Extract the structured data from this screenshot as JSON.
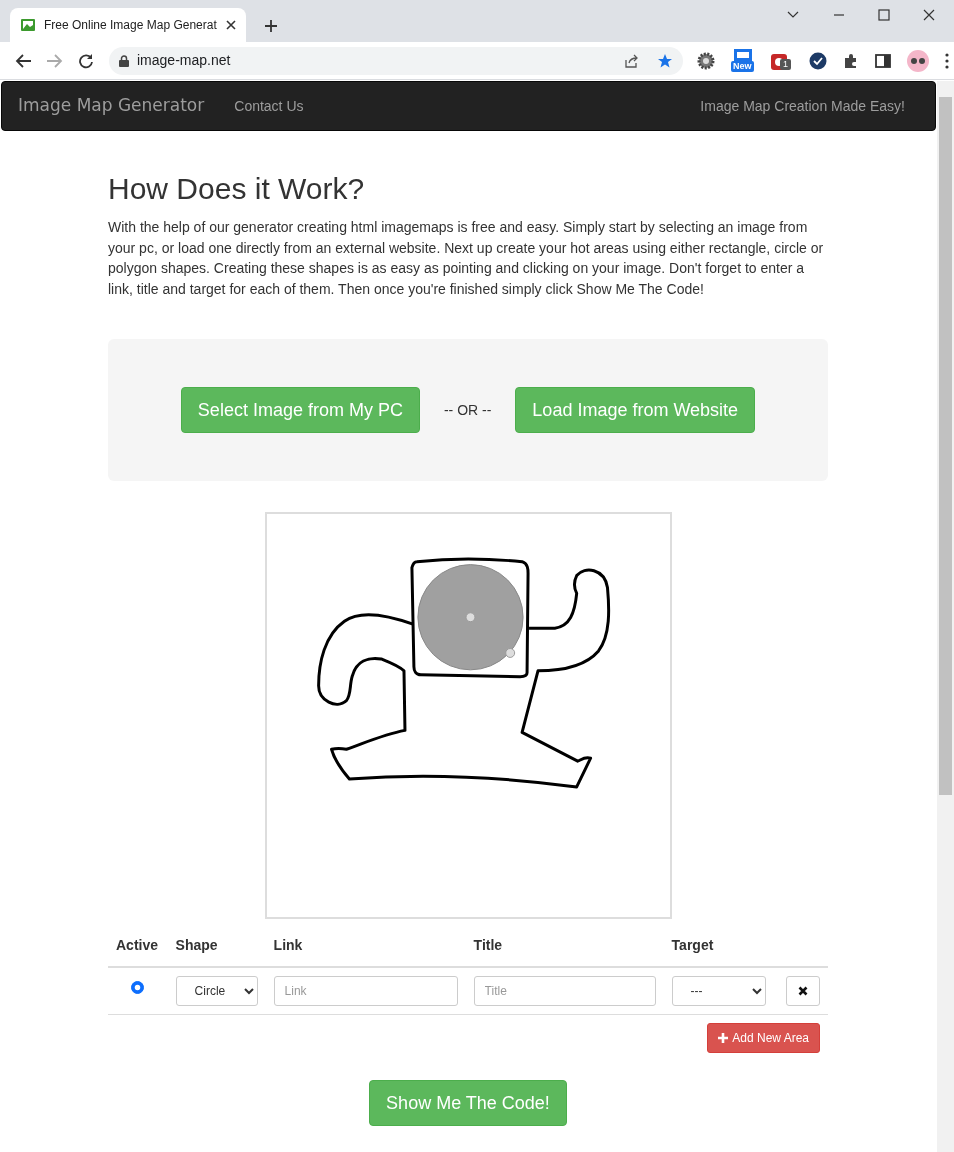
{
  "browser": {
    "tab_title": "Free Online Image Map Generat",
    "url": "image-map.net",
    "extension_badges": [
      "New",
      "1"
    ]
  },
  "navbar": {
    "brand": "Image Map Generator",
    "links": [
      {
        "label": "Contact Us"
      }
    ],
    "tagline": "Image Map Creation Made Easy!"
  },
  "intro": {
    "heading": "How Does it Work?",
    "text": "With the help of our generator creating html imagemaps is free and easy. Simply start by selecting an image from your pc, or load one directly from an external website. Next up create your hot areas using either rectangle, circle or polygon shapes. Creating these shapes is as easy as pointing and clicking on your image. Don't forget to enter a link, title and target for each of them. Then once you're finished simply click Show Me The Code!"
  },
  "image_source": {
    "buttons": [
      "Select Image from My PC",
      "Load Image from Website"
    ],
    "separator": "-- OR --"
  },
  "areas": {
    "columns": [
      "Active",
      "Shape",
      "Link",
      "Title",
      "Target"
    ],
    "rows": [
      {
        "selected": true,
        "shape": "Circle",
        "link_placeholder": "Link",
        "title_placeholder": "Title",
        "target": "---"
      }
    ]
  },
  "add_button": "Add New Area",
  "code_button": "Show Me The Code!"
}
